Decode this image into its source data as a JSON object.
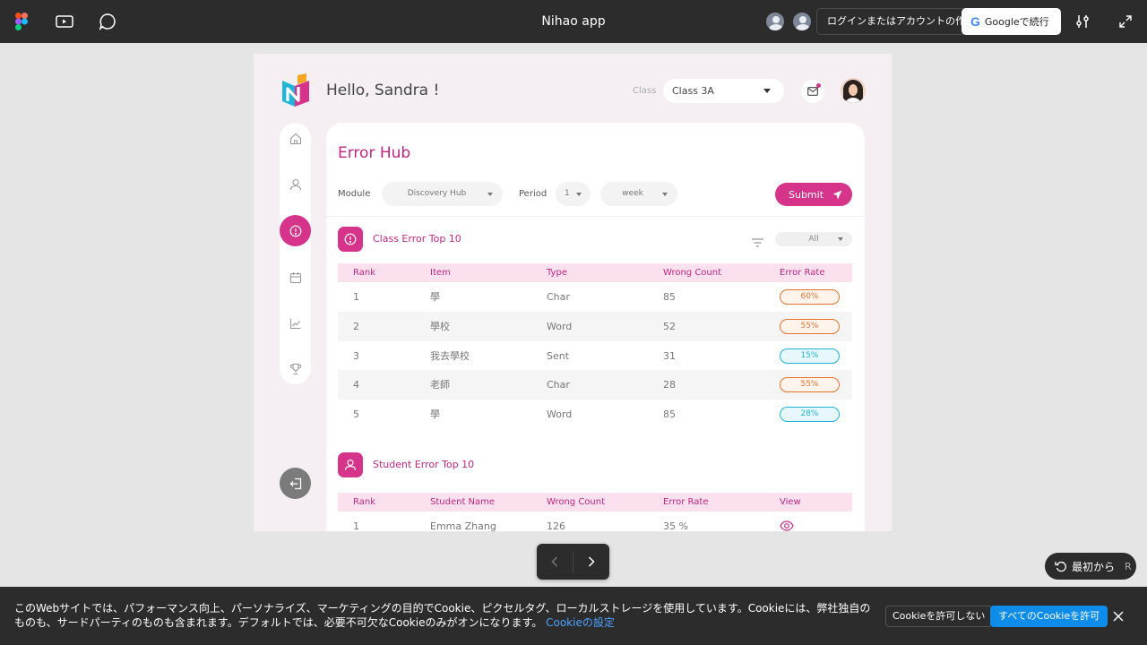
{
  "topbar": {
    "title": "Nihao app",
    "login_label": "ログインまたはアカウントの作成",
    "google_label": "Googleで続行",
    "google_g": "G"
  },
  "header": {
    "greeting": "Hello, Sandra !",
    "class_label": "Class",
    "class_value": "Class 3A"
  },
  "page": {
    "title": "Error Hub",
    "module_label": "Module",
    "module_value": "Discovery Hub",
    "period_label": "Period",
    "period_value": "1",
    "period_unit": "week",
    "submit_label": "Submit"
  },
  "class_errors": {
    "title": "Class Error Top 10",
    "filter_value": "All",
    "columns": [
      "Rank",
      "Item",
      "Type",
      "Wrong Count",
      "Error Rate"
    ],
    "rows": [
      {
        "rank": "1",
        "item": "學",
        "type": "Char",
        "count": "85",
        "rate": "60%",
        "rate_color": "orange"
      },
      {
        "rank": "2",
        "item": "學校",
        "type": "Word",
        "count": "52",
        "rate": "55%",
        "rate_color": "orange"
      },
      {
        "rank": "3",
        "item": "我去學校",
        "type": "Sent",
        "count": "31",
        "rate": "15%",
        "rate_color": "cyan"
      },
      {
        "rank": "4",
        "item": "老師",
        "type": "Char",
        "count": "28",
        "rate": "55%",
        "rate_color": "orange"
      },
      {
        "rank": "5",
        "item": "學",
        "type": "Word",
        "count": "85",
        "rate": "28%",
        "rate_color": "cyan"
      }
    ]
  },
  "student_errors": {
    "title": "Student Error Top 10",
    "columns": [
      "Rank",
      "Student Name",
      "Wrong Count",
      "Error Rate",
      "View"
    ],
    "rows": [
      {
        "rank": "1",
        "name": "Emma Zhang",
        "count": "126",
        "rate": "35 %"
      }
    ]
  },
  "controls": {
    "restart_label": "最初から",
    "restart_key": "R"
  },
  "cookie": {
    "text": "このWebサイトでは、パフォーマンス向上、パーソナライズ、マーケティングの目的でCookie、ピクセルタグ、ローカルストレージを使用しています。Cookieには、弊社独自のものも、サードパーティのものも含まれます。デフォルトでは、必要不可欠なCookieのみがオンになります。",
    "settings_link": "Cookieの設定",
    "reject_label": "Cookieを許可しない",
    "accept_label": "すべてのCookieを許可"
  },
  "colors": {
    "accent": "#d6338b",
    "accent_text": "#c0277f",
    "table_header": "#fbe0ee",
    "rate_orange": "#e8722c",
    "rate_cyan": "#1fb4d8",
    "chrome": "#2c2c2c",
    "canvas_bg": "#f5eff4"
  },
  "icons": [
    "figma-logo-icon",
    "present-icon",
    "comment-icon",
    "settings-sliders-icon",
    "fullscreen-icon",
    "home-icon",
    "user-icon",
    "alert-icon",
    "calendar-icon",
    "chart-icon",
    "trophy-icon",
    "logout-icon",
    "mail-icon",
    "send-icon",
    "filter-icon",
    "eye-icon",
    "chevron-left-icon",
    "chevron-right-icon",
    "undo-icon",
    "close-icon"
  ]
}
